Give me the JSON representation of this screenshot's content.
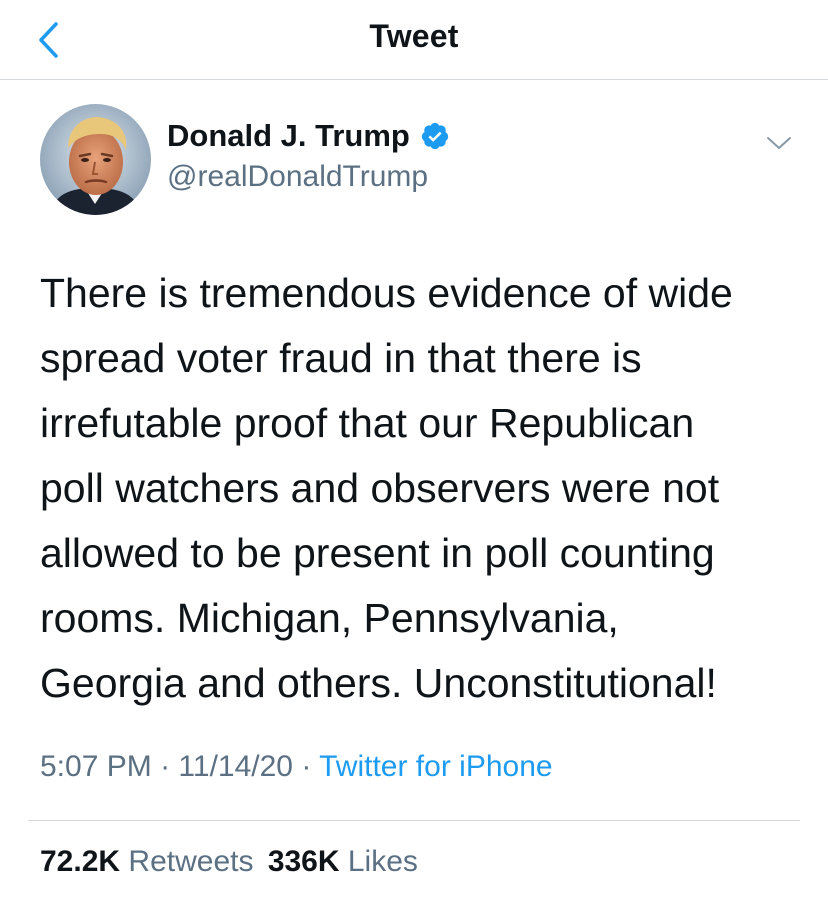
{
  "header": {
    "title": "Tweet",
    "back_icon": "chevron-left-icon"
  },
  "author": {
    "name": "Donald J. Trump",
    "handle": "@realDonaldTrump",
    "verified_icon": "verified-badge-icon",
    "menu_icon": "chevron-down-icon"
  },
  "tweet": {
    "text": "There is tremendous evidence of wide\nspread voter fraud in that there is\nirrefutable proof that our Republican\npoll watchers and observers were not\nallowed to be present in poll counting\nrooms. Michigan, Pennsylvania,\nGeorgia and others. Unconstitutional!",
    "time": "5:07 PM",
    "separator": "·",
    "date": "11/14/20",
    "source": "Twitter for iPhone"
  },
  "stats": {
    "retweets_count": "72.2K",
    "retweets_label": "Retweets",
    "likes_count": "336K",
    "likes_label": "Likes"
  },
  "colors": {
    "accent": "#1d9bf0",
    "secondary_text": "#5b7083",
    "divider": "#d6d9dc"
  }
}
